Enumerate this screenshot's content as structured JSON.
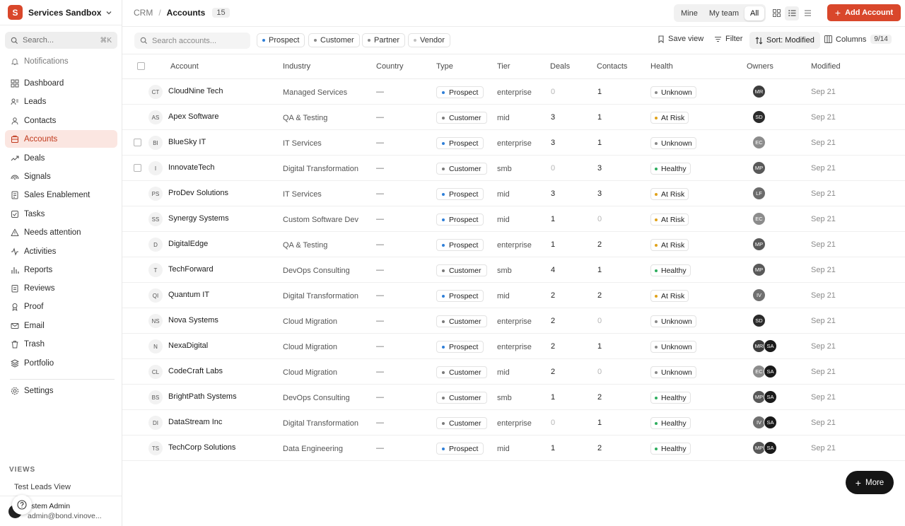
{
  "workspace": {
    "initial": "S",
    "name": "Services Sandbox"
  },
  "sidebar": {
    "search_placeholder": "Search...",
    "search_shortcut": "⌘K",
    "items": [
      {
        "label": "Notifications",
        "icon": "bell-icon",
        "state": "muted"
      },
      {
        "label": "Dashboard",
        "icon": "dashboard-icon",
        "state": "normal"
      },
      {
        "label": "Leads",
        "icon": "leads-icon",
        "state": "normal"
      },
      {
        "label": "Contacts",
        "icon": "contacts-icon",
        "state": "normal"
      },
      {
        "label": "Accounts",
        "icon": "accounts-icon",
        "state": "active"
      },
      {
        "label": "Deals",
        "icon": "deals-icon",
        "state": "normal"
      },
      {
        "label": "Signals",
        "icon": "signals-icon",
        "state": "normal"
      },
      {
        "label": "Sales Enablement",
        "icon": "enablement-icon",
        "state": "normal"
      },
      {
        "label": "Tasks",
        "icon": "tasks-icon",
        "state": "normal"
      },
      {
        "label": "Needs attention",
        "icon": "warning-icon",
        "state": "normal"
      },
      {
        "label": "Activities",
        "icon": "activity-icon",
        "state": "normal"
      },
      {
        "label": "Reports",
        "icon": "reports-icon",
        "state": "normal"
      },
      {
        "label": "Reviews",
        "icon": "reviews-icon",
        "state": "normal"
      },
      {
        "label": "Proof",
        "icon": "proof-icon",
        "state": "normal"
      },
      {
        "label": "Email",
        "icon": "email-icon",
        "state": "normal"
      },
      {
        "label": "Trash",
        "icon": "trash-icon",
        "state": "normal"
      },
      {
        "label": "Portfolio",
        "icon": "portfolio-icon",
        "state": "normal"
      }
    ],
    "settings_label": "Settings",
    "views_title": "VIEWS",
    "views_items": [
      "Test Leads View"
    ],
    "user": {
      "name": "ystem Admin",
      "email": "admin@bond.vinove..."
    }
  },
  "topbar": {
    "breadcrumb_root": "CRM",
    "breadcrumb_current": "Accounts",
    "count": "15",
    "scope_tabs": [
      {
        "label": "Mine",
        "active": false
      },
      {
        "label": "My team",
        "active": false
      },
      {
        "label": "All",
        "active": true
      }
    ],
    "add_button": "Add Account",
    "accent": "#d9472b"
  },
  "filterbar": {
    "search_placeholder": "Search accounts...",
    "chips": [
      {
        "label": "Prospect",
        "color": "#2f7fd8"
      },
      {
        "label": "Customer",
        "color": "#8a8a8a"
      },
      {
        "label": "Partner",
        "color": "#8a8a8a"
      },
      {
        "label": "Vendor",
        "color": "#c0c0c0"
      }
    ],
    "save_view": "Save view",
    "filter": "Filter",
    "sort": "Sort: Modified",
    "columns": "Columns",
    "columns_count": "9/14"
  },
  "table": {
    "headers": [
      "Account",
      "Industry",
      "Country",
      "Type",
      "Tier",
      "Deals",
      "Contacts",
      "Health",
      "Owners",
      "Modified"
    ],
    "rows": [
      {
        "abbr": "CT",
        "name": "CloudNine Tech",
        "industry": "Managed Services",
        "country": "—",
        "type": "Prospect",
        "tier": "enterprise",
        "deals": "0",
        "contacts": "1",
        "health": "Unknown",
        "owners": [
          "MR"
        ],
        "modified": "Sep 21",
        "checkbox": false
      },
      {
        "abbr": "AS",
        "name": "Apex Software",
        "industry": "QA & Testing",
        "country": "—",
        "type": "Customer",
        "tier": "mid",
        "deals": "3",
        "contacts": "1",
        "health": "At Risk",
        "owners": [
          "SD"
        ],
        "modified": "Sep 21",
        "checkbox": false
      },
      {
        "abbr": "BI",
        "name": "BlueSky IT",
        "industry": "IT Services",
        "country": "—",
        "type": "Prospect",
        "tier": "enterprise",
        "deals": "3",
        "contacts": "1",
        "health": "Unknown",
        "owners": [
          "EC"
        ],
        "modified": "Sep 21",
        "checkbox": true
      },
      {
        "abbr": "I",
        "name": "InnovateTech",
        "industry": "Digital Transformation",
        "country": "—",
        "type": "Customer",
        "tier": "smb",
        "deals": "0",
        "contacts": "3",
        "health": "Healthy",
        "owners": [
          "MP"
        ],
        "modified": "Sep 21",
        "checkbox": true
      },
      {
        "abbr": "PS",
        "name": "ProDev Solutions",
        "industry": "IT Services",
        "country": "—",
        "type": "Prospect",
        "tier": "mid",
        "deals": "3",
        "contacts": "3",
        "health": "At Risk",
        "owners": [
          "LF"
        ],
        "modified": "Sep 21",
        "checkbox": false
      },
      {
        "abbr": "SS",
        "name": "Synergy Systems",
        "industry": "Custom Software Dev",
        "country": "—",
        "type": "Prospect",
        "tier": "mid",
        "deals": "1",
        "contacts": "0",
        "health": "At Risk",
        "owners": [
          "EC"
        ],
        "modified": "Sep 21",
        "checkbox": false
      },
      {
        "abbr": "D",
        "name": "DigitalEdge",
        "industry": "QA & Testing",
        "country": "—",
        "type": "Prospect",
        "tier": "enterprise",
        "deals": "1",
        "contacts": "2",
        "health": "At Risk",
        "owners": [
          "MP"
        ],
        "modified": "Sep 21",
        "checkbox": false
      },
      {
        "abbr": "T",
        "name": "TechForward",
        "industry": "DevOps Consulting",
        "country": "—",
        "type": "Customer",
        "tier": "smb",
        "deals": "4",
        "contacts": "1",
        "health": "Healthy",
        "owners": [
          "MP"
        ],
        "modified": "Sep 21",
        "checkbox": false
      },
      {
        "abbr": "QI",
        "name": "Quantum IT",
        "industry": "Digital Transformation",
        "country": "—",
        "type": "Prospect",
        "tier": "mid",
        "deals": "2",
        "contacts": "2",
        "health": "At Risk",
        "owners": [
          "IV"
        ],
        "modified": "Sep 21",
        "checkbox": false
      },
      {
        "abbr": "NS",
        "name": "Nova Systems",
        "industry": "Cloud Migration",
        "country": "—",
        "type": "Customer",
        "tier": "enterprise",
        "deals": "2",
        "contacts": "0",
        "health": "Unknown",
        "owners": [
          "SD"
        ],
        "modified": "Sep 21",
        "checkbox": false
      },
      {
        "abbr": "N",
        "name": "NexaDigital",
        "industry": "Cloud Migration",
        "country": "—",
        "type": "Prospect",
        "tier": "enterprise",
        "deals": "2",
        "contacts": "1",
        "health": "Unknown",
        "owners": [
          "MR",
          "SA"
        ],
        "modified": "Sep 21",
        "checkbox": false
      },
      {
        "abbr": "CL",
        "name": "CodeCraft Labs",
        "industry": "Cloud Migration",
        "country": "—",
        "type": "Customer",
        "tier": "mid",
        "deals": "2",
        "contacts": "0",
        "health": "Unknown",
        "owners": [
          "EC",
          "SA"
        ],
        "modified": "Sep 21",
        "checkbox": false
      },
      {
        "abbr": "BS",
        "name": "BrightPath Systems",
        "industry": "DevOps Consulting",
        "country": "—",
        "type": "Customer",
        "tier": "smb",
        "deals": "1",
        "contacts": "2",
        "health": "Healthy",
        "owners": [
          "MP",
          "SA"
        ],
        "modified": "Sep 21",
        "checkbox": false
      },
      {
        "abbr": "DI",
        "name": "DataStream Inc",
        "industry": "Digital Transformation",
        "country": "—",
        "type": "Customer",
        "tier": "enterprise",
        "deals": "0",
        "contacts": "1",
        "health": "Healthy",
        "owners": [
          "IV",
          "SA"
        ],
        "modified": "Sep 21",
        "checkbox": false
      },
      {
        "abbr": "TS",
        "name": "TechCorp Solutions",
        "industry": "Data Engineering",
        "country": "—",
        "type": "Prospect",
        "tier": "mid",
        "deals": "1",
        "contacts": "2",
        "health": "Healthy",
        "owners": [
          "MP",
          "SA"
        ],
        "modified": "Sep 21",
        "checkbox": false
      }
    ]
  },
  "colors": {
    "type": {
      "Prospect": "#2f7fd8",
      "Customer": "#7a7a7a"
    },
    "health": {
      "Unknown": "#8a8a8a",
      "At Risk": "#e0a21a",
      "Healthy": "#2fae5f"
    },
    "owner": {
      "MR": "#3d3d3d",
      "SD": "#2b2b2b",
      "EC": "#8c8c8c",
      "MP": "#595959",
      "LF": "#6b6b6b",
      "IV": "#707070",
      "SA": "#1a1a1a"
    }
  },
  "more_button": "More"
}
